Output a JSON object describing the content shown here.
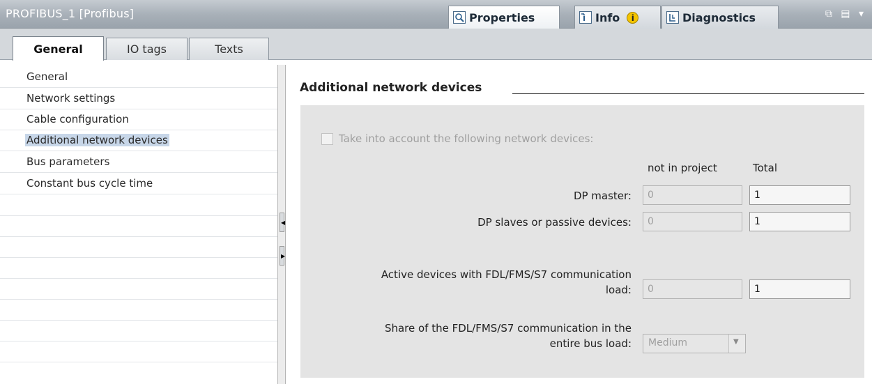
{
  "window": {
    "title": "PROFIBUS_1 [Profibus]",
    "tabs": [
      {
        "label": "Properties",
        "icon": "properties-icon"
      },
      {
        "label": "Info",
        "icon": "info-icon",
        "badge": "i"
      },
      {
        "label": "Diagnostics",
        "icon": "diagnostics-icon"
      }
    ],
    "controls": "⧉ ▤ ▾"
  },
  "subtabs": [
    "General",
    "IO tags",
    "Texts"
  ],
  "nav": {
    "items": [
      "General",
      "Network settings",
      "Cable configuration",
      "Additional network devices",
      "Bus parameters",
      "Constant bus cycle time"
    ],
    "selected": "Additional network devices"
  },
  "section": {
    "title": "Additional network devices",
    "checkbox_label": "Take into account the following network devices:",
    "checkbox_checked": false,
    "col_not_in_project": "not in project",
    "col_total": "Total",
    "rows": [
      {
        "label": "DP master:",
        "not_in_project": "0",
        "total": "1"
      },
      {
        "label": "DP slaves or passive devices:",
        "not_in_project": "0",
        "total": "1"
      },
      {
        "label_line1": "Active devices with FDL/FMS/S7 communication",
        "label_line2": "load:",
        "not_in_project": "0",
        "total": "1"
      }
    ],
    "share": {
      "label_line1": "Share of the FDL/FMS/S7 communication in the",
      "label_line2": "entire bus load:",
      "value": "Medium"
    }
  }
}
